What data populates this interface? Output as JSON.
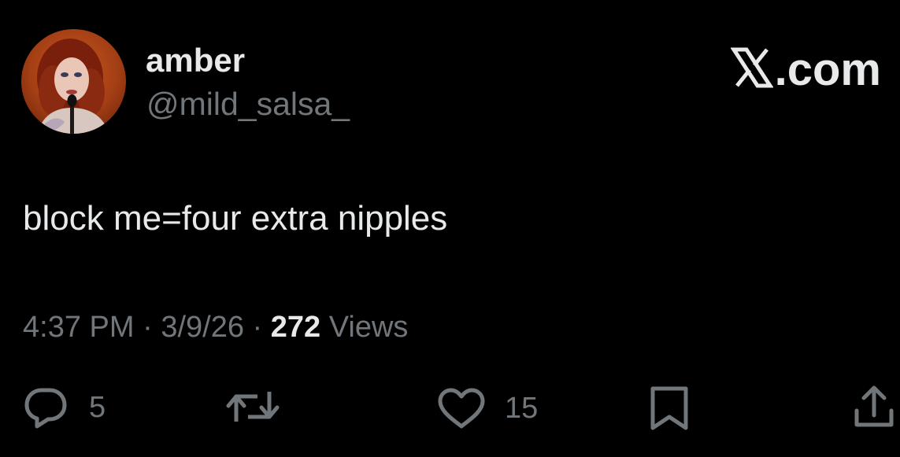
{
  "user": {
    "display_name": "amber",
    "handle": "@mild_salsa_",
    "avatar_icon": "avatar-photo"
  },
  "brand": {
    "label": ".com",
    "icon": "x-logo-icon"
  },
  "tweet": {
    "text": "block me=four extra nipples",
    "time": "4:37 PM",
    "separator1": " · ",
    "date": "3/9/26",
    "separator2": " · ",
    "views_count": "272",
    "views_label": " Views"
  },
  "actions": {
    "replies": "5",
    "likes": "15"
  },
  "colors": {
    "background": "#000000",
    "primary_text": "#e7e9ea",
    "secondary_text": "#71767b"
  }
}
